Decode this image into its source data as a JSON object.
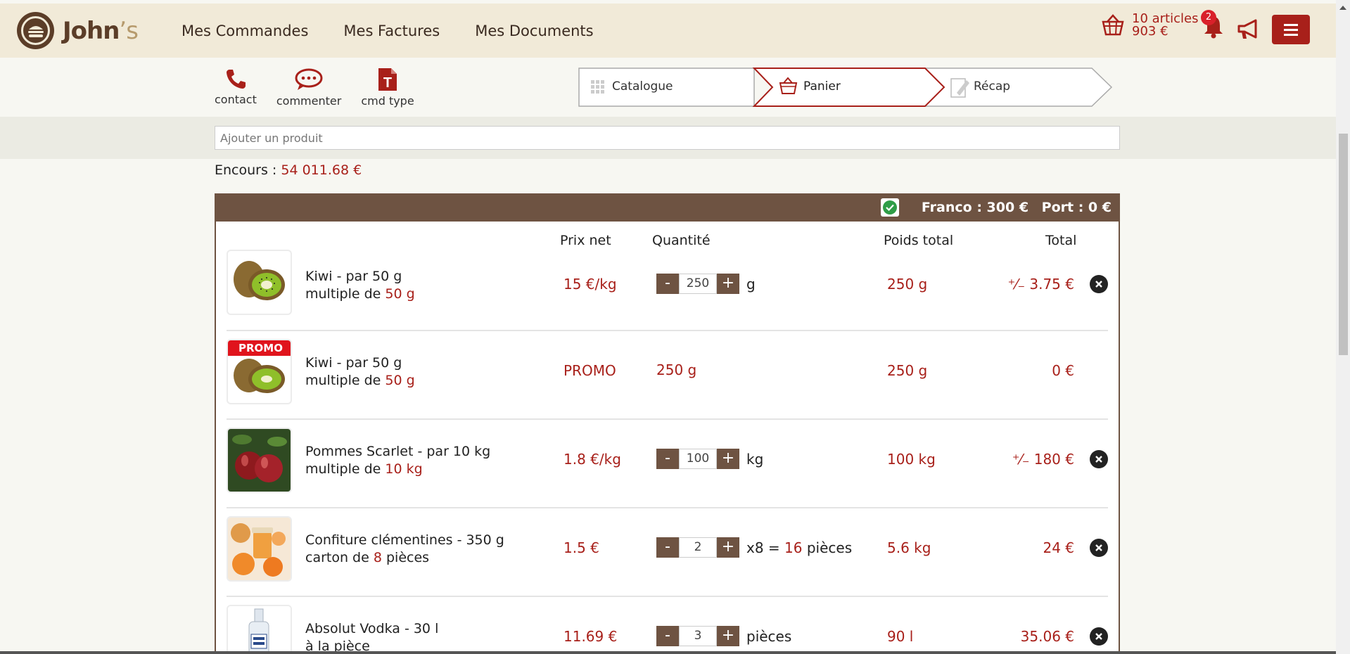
{
  "brand": {
    "name": "John",
    "suffix": "’s"
  },
  "nav": [
    "Mes Commandes",
    "Mes Factures",
    "Mes Documents"
  ],
  "cart_summary": {
    "articles": "10 articles",
    "amount": "903 €"
  },
  "notifications": {
    "count": "2"
  },
  "actions": [
    {
      "label": "contact",
      "icon": "phone-icon"
    },
    {
      "label": "commenter",
      "icon": "speech-bubble-icon"
    },
    {
      "label": "cmd type",
      "icon": "document-t-icon"
    }
  ],
  "steps": [
    {
      "label": "Catalogue",
      "icon": "grid-icon",
      "active": false
    },
    {
      "label": "Panier",
      "icon": "basket-icon",
      "active": true
    },
    {
      "label": "Récap",
      "icon": "edit-document-icon",
      "active": false
    }
  ],
  "search": {
    "placeholder": "Ajouter un produit"
  },
  "encours": {
    "label": "Encours :",
    "value": "54 011.68 €"
  },
  "cart_header": {
    "franco": "Franco : 300 €",
    "port": "Port : 0 €"
  },
  "columns": {
    "price": "Prix net",
    "qty": "Quantité",
    "weight": "Poids total",
    "total": "Total"
  },
  "items": [
    {
      "name": "Kiwi - par 50 g",
      "sub_prefix": "multiple de ",
      "sub_value": "50 g",
      "sub_suffix": "",
      "price": "15 €/kg",
      "qty": "250",
      "unit": "g",
      "weight": "250 g",
      "total": "⁺⁄₋ 3.75 €",
      "image": "kiwi",
      "promo": false
    },
    {
      "name": "Kiwi - par 50 g",
      "sub_prefix": "multiple de ",
      "sub_value": "50 g",
      "sub_suffix": "",
      "price": "PROMO",
      "qty_text": "250 g",
      "weight": "250 g",
      "total": "0 €",
      "image": "kiwi",
      "promo": true,
      "promo_label": "PROMO"
    },
    {
      "name": "Pommes Scarlet - par 10 kg",
      "sub_prefix": "multiple de ",
      "sub_value": "10 kg",
      "sub_suffix": "",
      "price": "1.8 €/kg",
      "qty": "100",
      "unit": "kg",
      "weight": "100 kg",
      "total": "⁺⁄₋ 180 €",
      "image": "apples",
      "promo": false
    },
    {
      "name": "Confiture clémentines - 350 g",
      "sub_prefix": "carton de ",
      "sub_value": "8",
      "sub_suffix": " pièces",
      "price": "1.5 €",
      "qty": "2",
      "unit_prefix": "x8 = ",
      "unit_value": "16",
      "unit_suffix": " pièces",
      "weight": "5.6 kg",
      "total": "24 €",
      "image": "jam",
      "promo": false
    },
    {
      "name": "Absolut Vodka - 30 l",
      "sub_prefix": "à la pièce",
      "sub_value": "",
      "sub_suffix": "",
      "price": "11.69 €",
      "qty": "3",
      "unit": "pièces",
      "weight": "90 l",
      "total": "35.06 €",
      "image": "vodka",
      "promo": false
    }
  ]
}
